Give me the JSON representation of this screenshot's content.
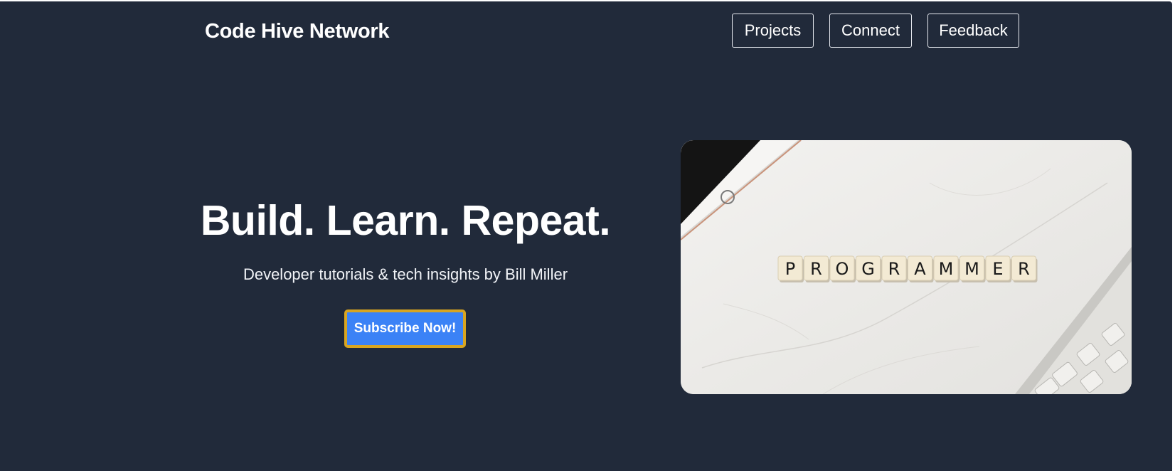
{
  "header": {
    "brand": "Code Hive Network",
    "nav": [
      {
        "label": "Projects"
      },
      {
        "label": "Connect"
      },
      {
        "label": "Feedback"
      }
    ]
  },
  "hero": {
    "title": "Build. Learn. Repeat.",
    "subtitle": "Developer tutorials & tech insights by Bill Miller",
    "cta_label": "Subscribe Now!",
    "image": {
      "tiles": [
        "P",
        "R",
        "O",
        "G",
        "R",
        "A",
        "M",
        "M",
        "E",
        "R"
      ]
    }
  },
  "colors": {
    "background": "#212a3a",
    "cta_fill": "#3b82f6",
    "cta_border": "#d9a520",
    "text": "#ffffff"
  }
}
